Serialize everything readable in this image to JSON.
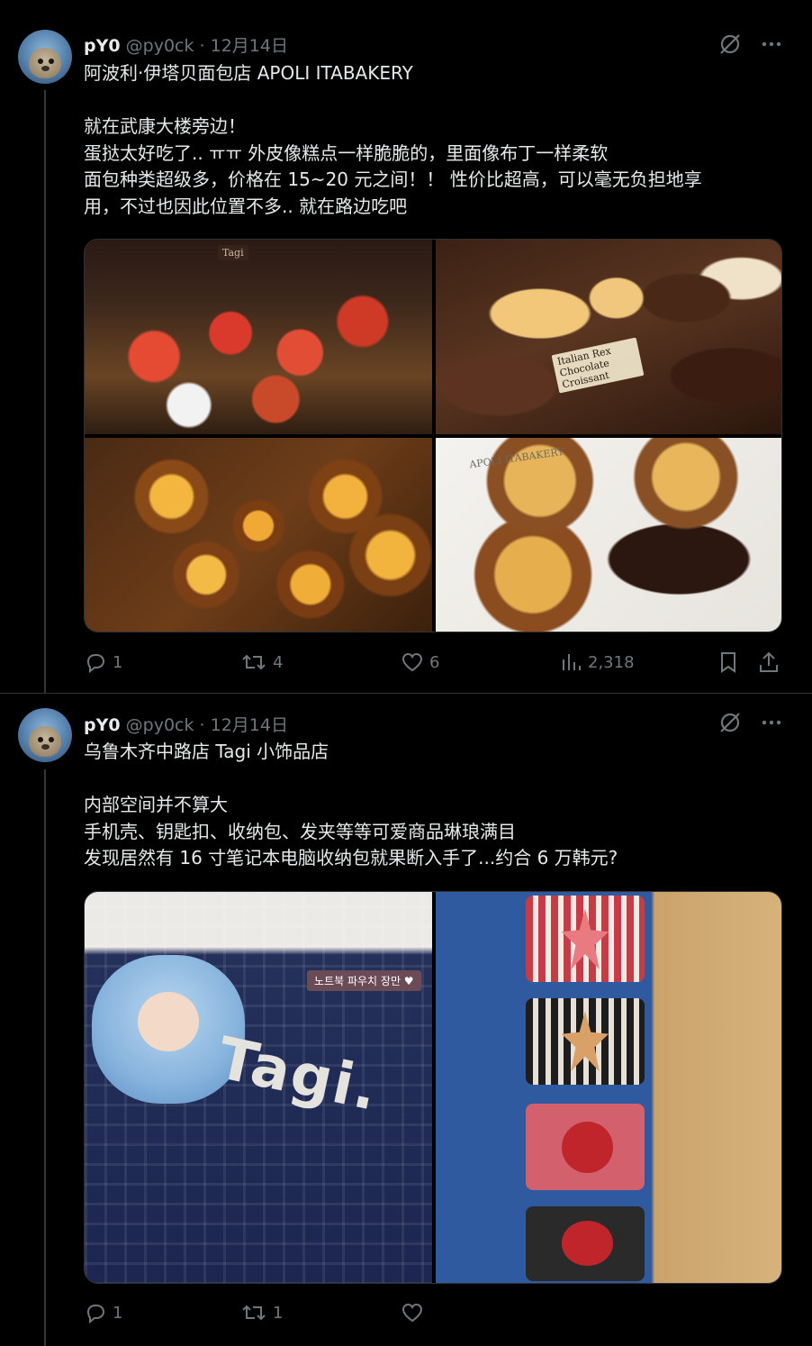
{
  "tweets": [
    {
      "author_name": "pY0",
      "author_handle": "@py0ck",
      "separator": "·",
      "date": "12月14日",
      "lines": [
        "阿波利·伊塔贝面包店 APOLI ITABAKERY",
        "",
        "就在武康大楼旁边！",
        "蛋挞太好吃了.. ㅠㅠ 外皮像糕点一样脆脆的，里面像布丁一样柔软",
        "面包种类超级多，价格在 15~20 元之间！！ 性价比超高，可以毫无负担地享",
        "用，不过也因此位置不多.. 就在路边吃吧"
      ],
      "photo_labels": {
        "tarts_sign": "Tagi",
        "choc_sign": "Italian Rex Chocolate Croissant",
        "plate_brand": "APOLI ITABAKERY"
      },
      "actions": {
        "replies": "1",
        "reposts": "4",
        "likes": "6",
        "views": "2,318"
      }
    },
    {
      "author_name": "pY0",
      "author_handle": "@py0ck",
      "separator": "·",
      "date": "12月14日",
      "lines": [
        "乌鲁木齐中路店 Tagi 小饰品店",
        "",
        "内部空间并不算大",
        "手机壳、钥匙扣、收纳包、发夹等等可爱商品琳琅满目",
        "发现居然有 16 寸笔记本电脑收纳包就果断入手了...约合 6 万韩元?"
      ],
      "photo_labels": {
        "bag_brand": "Tagi.",
        "sticker": "노트북 파우치 장만 ♥"
      },
      "actions": {
        "replies": "1",
        "reposts": "1"
      }
    }
  ]
}
